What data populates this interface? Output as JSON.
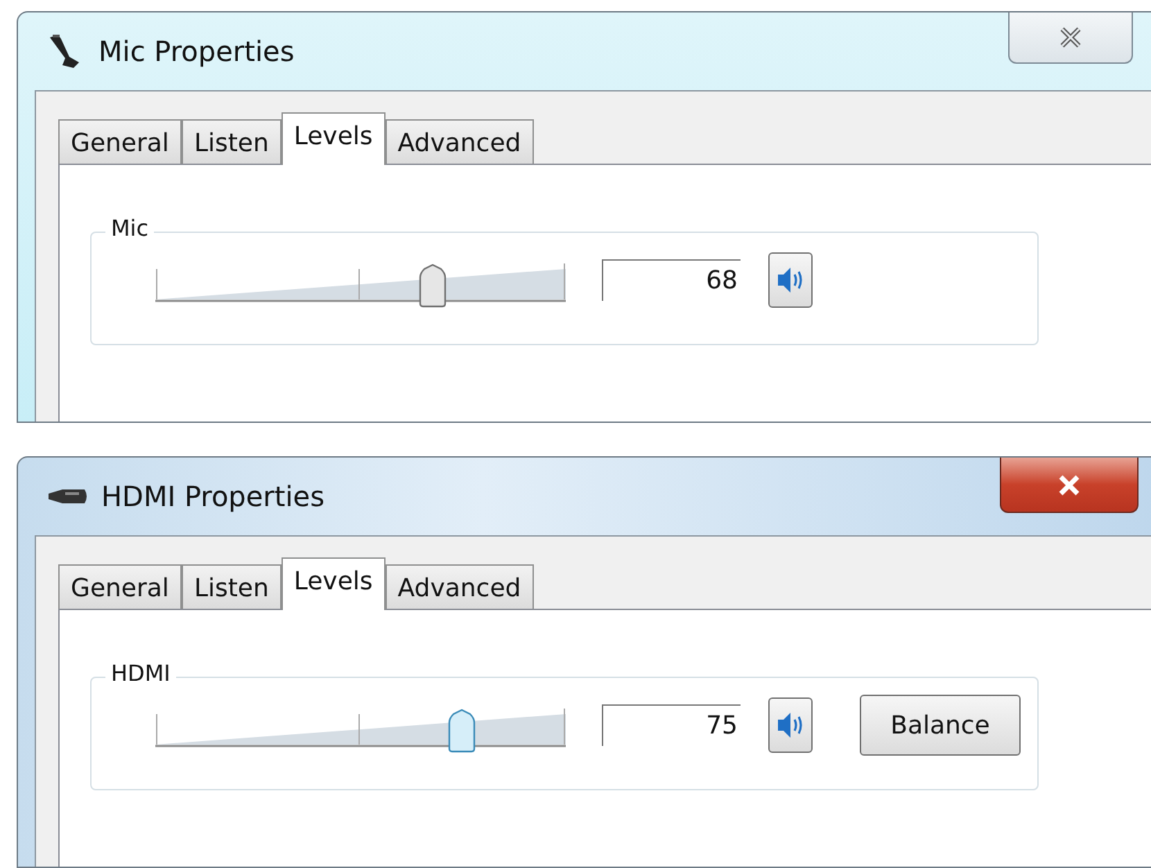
{
  "windows": [
    {
      "title": "Mic Properties",
      "kind": "microphone",
      "active": false,
      "tabs": [
        {
          "label": "General",
          "selected": false
        },
        {
          "label": "Listen",
          "selected": false
        },
        {
          "label": "Levels",
          "selected": true
        },
        {
          "label": "Advanced",
          "selected": false
        }
      ],
      "group": {
        "label": "Mic",
        "level": 0.68,
        "focused": false,
        "value": "68"
      }
    },
    {
      "title": "HDMI Properties",
      "kind": "hdmi",
      "active": true,
      "tabs": [
        {
          "label": "General",
          "selected": false
        },
        {
          "label": "Listen",
          "selected": false
        },
        {
          "label": "Levels",
          "selected": true
        },
        {
          "label": "Advanced",
          "selected": false
        }
      ],
      "group": {
        "label": "HDMI",
        "level": 0.75,
        "focused": true,
        "value": "75",
        "buttons": [
          "Balance"
        ]
      }
    }
  ]
}
